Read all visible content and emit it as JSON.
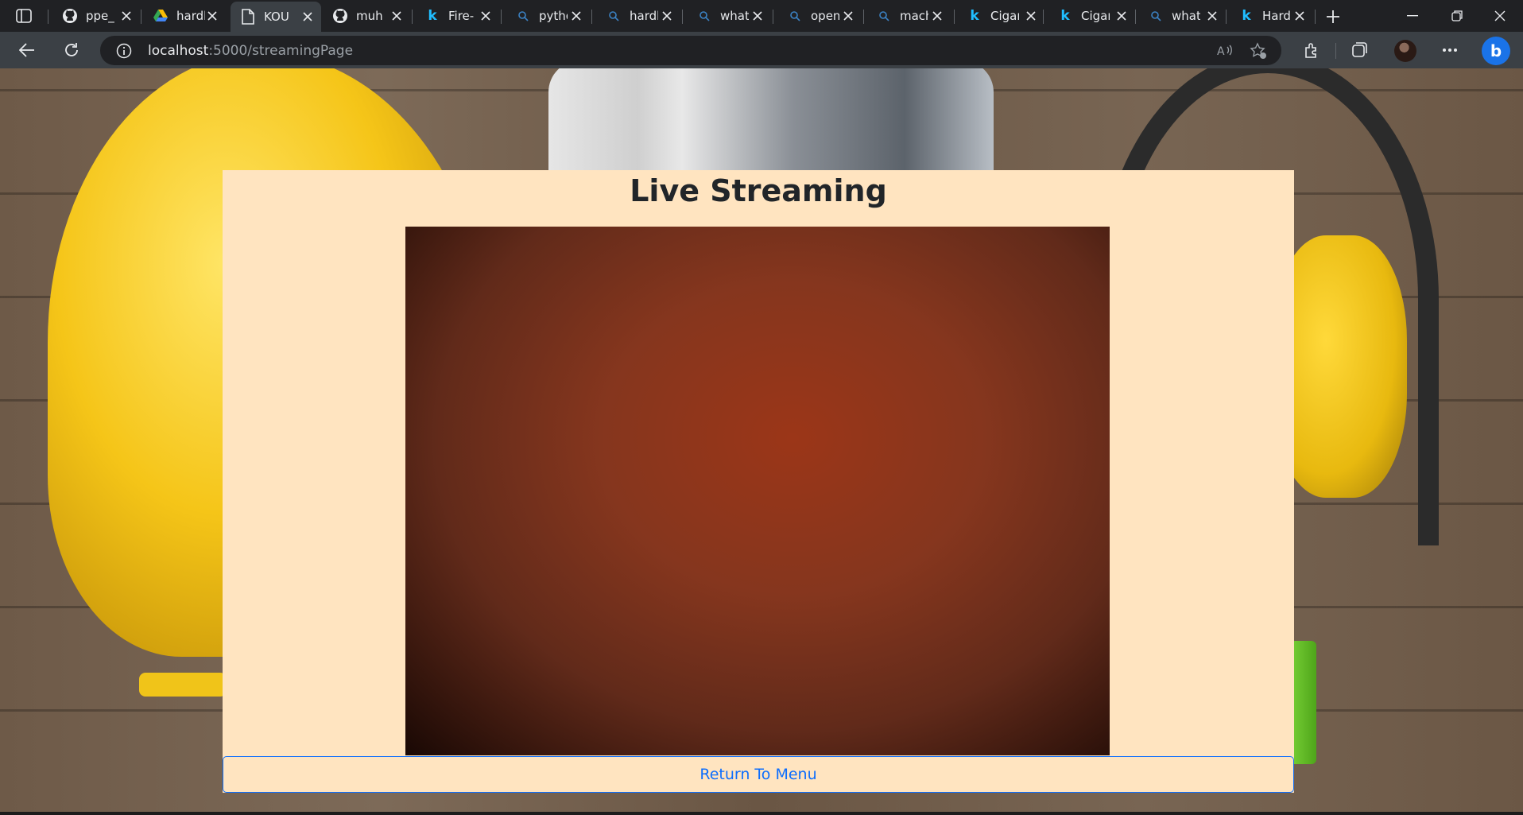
{
  "browser": {
    "tabs": [
      {
        "label": "ppe_",
        "icon": "github-icon"
      },
      {
        "label": "hardh",
        "icon": "google-drive-icon"
      },
      {
        "label": "KOU",
        "icon": "page-icon",
        "active": true
      },
      {
        "label": "muh",
        "icon": "github-icon"
      },
      {
        "label": "Fire-",
        "icon": "kaggle-icon"
      },
      {
        "label": "pytho",
        "icon": "search-icon"
      },
      {
        "label": "hardh",
        "icon": "search-icon"
      },
      {
        "label": "what",
        "icon": "search-icon"
      },
      {
        "label": "open",
        "icon": "search-icon"
      },
      {
        "label": "mach",
        "icon": "search-icon"
      },
      {
        "label": "Cigar",
        "icon": "kaggle-icon"
      },
      {
        "label": "Cigar",
        "icon": "kaggle-icon"
      },
      {
        "label": "what",
        "icon": "search-icon"
      },
      {
        "label": "Hard",
        "icon": "kaggle-icon"
      }
    ],
    "address": {
      "host": "localhost",
      "path": ":5000/streamingPage"
    }
  },
  "page": {
    "title": "Live Streaming",
    "return_button": "Return To Menu"
  },
  "colors": {
    "panel_background": "#ffe4c0",
    "button_accent": "#0d6efd",
    "title_text": "#212529"
  }
}
